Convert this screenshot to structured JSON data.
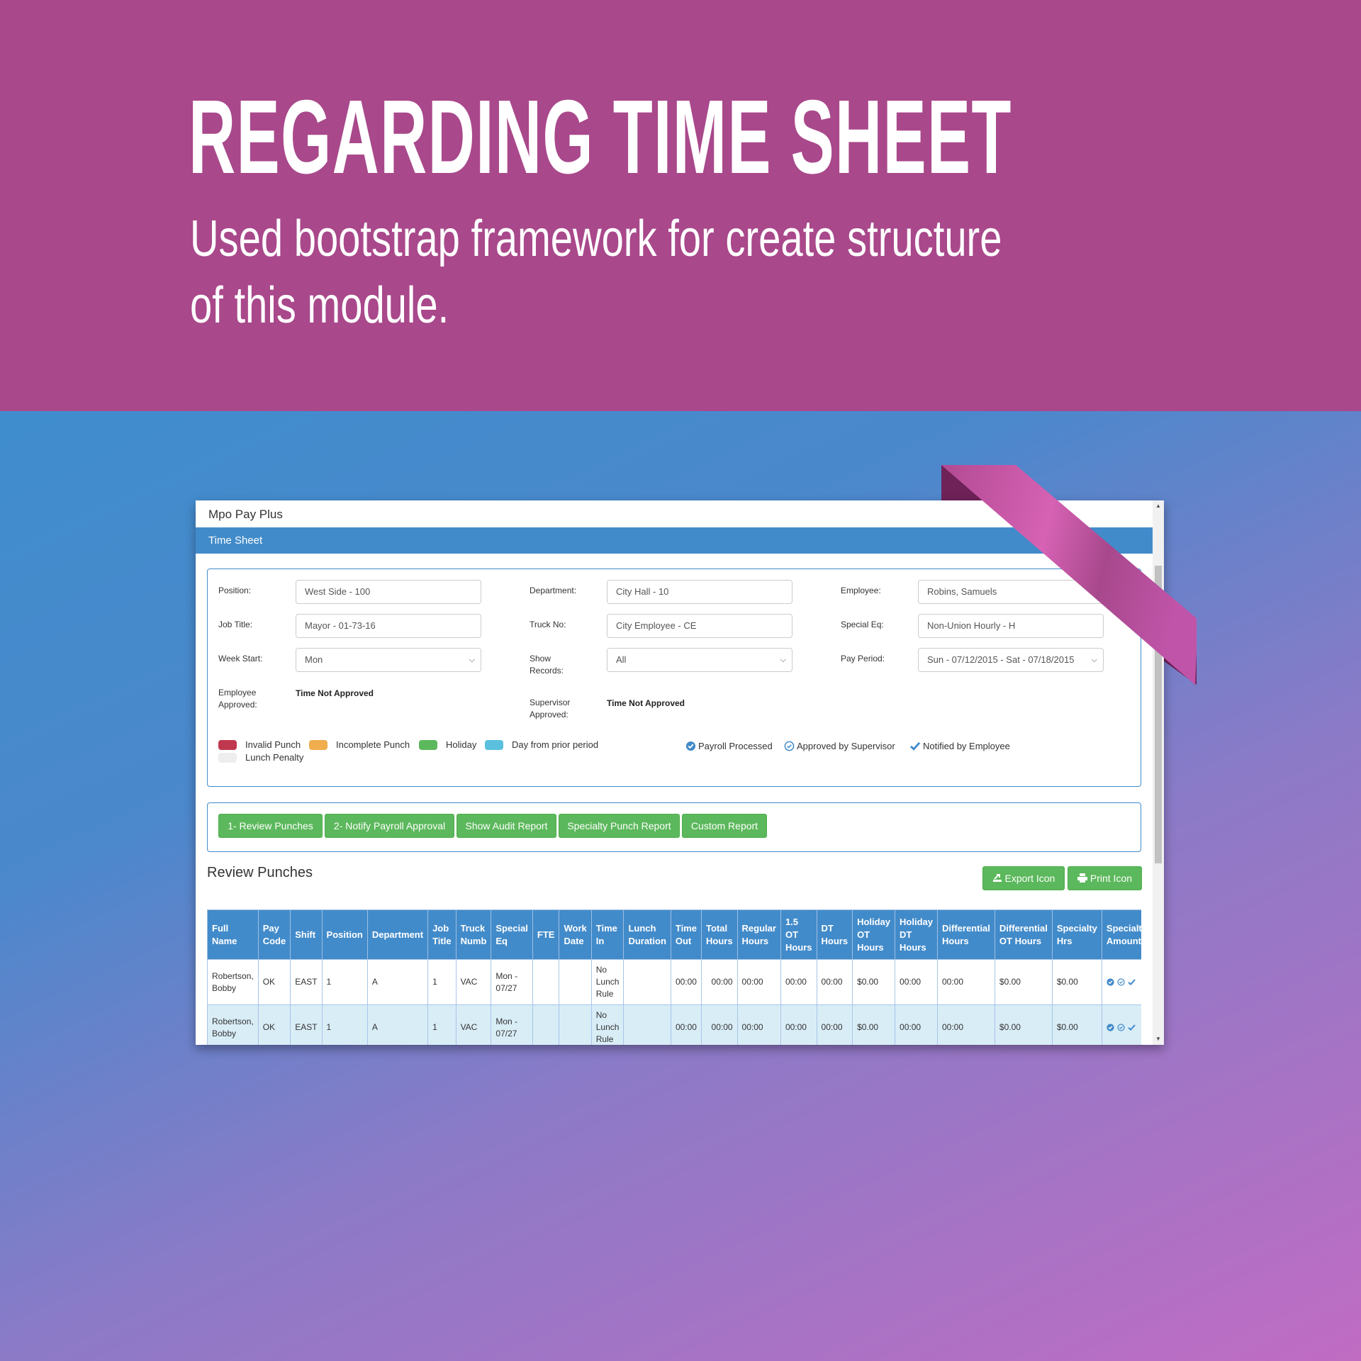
{
  "banner": {
    "headline": "REGARDING TIME SHEET",
    "subhead_line1": "Used bootstrap framework for create structure",
    "subhead_line2": "of this module."
  },
  "app": {
    "title": "Mpo Pay Plus",
    "header": "Time Sheet"
  },
  "filters": {
    "position": {
      "label": "Position:",
      "value": "West Side - 100"
    },
    "job_title": {
      "label": "Job Title:",
      "value": "Mayor - 01-73-16"
    },
    "week_start": {
      "label": "Week Start:",
      "value": "Mon"
    },
    "employee_approved": {
      "label_line1": "Employee",
      "label_line2": "Approved:",
      "value": "Time Not Approved"
    },
    "department": {
      "label": "Department:",
      "value": "City Hall - 10"
    },
    "truck_no": {
      "label": "Truck No:",
      "value": "City Employee - CE"
    },
    "show_records": {
      "label_line1": "Show",
      "label_line2": "Records:",
      "value": "All"
    },
    "supervisor_approved": {
      "label_line1": "Supervisor",
      "label_line2": "Approved:",
      "value": "Time Not Approved"
    },
    "employee": {
      "label": "Employee:",
      "value": "Robins, Samuels"
    },
    "special_eq": {
      "label": "Special Eq:",
      "value": "Non-Union Hourly - H"
    },
    "pay_period": {
      "label": "Pay Period:",
      "value": "Sun - 07/12/2015 - Sat - 07/18/2015"
    }
  },
  "legend": {
    "colors": [
      {
        "label": "Invalid Punch",
        "color": "#c0384f"
      },
      {
        "label": "Incomplete Punch",
        "color": "#f0ad4e"
      },
      {
        "label": "Holiday",
        "color": "#5cb85c"
      },
      {
        "label": "Day from prior period",
        "color": "#5bc0de"
      },
      {
        "label": "Lunch Penalty",
        "color": "#eeeeee"
      }
    ],
    "statuses": [
      {
        "label": "Payroll Processed",
        "icon": "check-circle-solid-icon"
      },
      {
        "label": "Approved by Supervisor",
        "icon": "check-circle-outline-icon"
      },
      {
        "label": "Notified by Employee",
        "icon": "check-icon"
      }
    ]
  },
  "actions": [
    "1- Review Punches",
    "2- Notify Payroll Approval",
    "Show Audit Report",
    "Specialty Punch Report",
    "Custom Report"
  ],
  "review": {
    "title": "Review Punches",
    "export_label": "Export Icon",
    "print_label": "Print Icon"
  },
  "table": {
    "columns": [
      "Full Name",
      "Pay Code",
      "Shift",
      "Position",
      "Department",
      "Job Title",
      "Truck Numb",
      "Special Eq",
      "FTE",
      "Work Date",
      "Time In",
      "Lunch Duration",
      "Time Out",
      "Total Hours",
      "Regular Hours",
      "1.5 OT Hours",
      "DT Hours",
      "Holiday OT Hours",
      "Holiday DT Hours",
      "Differential Hours",
      "Differential OT Hours",
      "Specialty Hrs",
      "Specialty Amount"
    ],
    "rows": [
      [
        "Robertson, Bobby",
        "OK",
        "EAST",
        "1",
        "A",
        "1",
        "VAC",
        "Mon - 07/27",
        "",
        "",
        "No Lunch Rule",
        "",
        "00:00",
        "00:00",
        "00:00",
        "00:00",
        "00:00",
        "$0.00",
        "00:00",
        "00:00",
        "$0.00",
        "$0.00",
        ""
      ],
      [
        "Robertson, Bobby",
        "OK",
        "EAST",
        "1",
        "A",
        "1",
        "VAC",
        "Mon - 07/27",
        "",
        "",
        "No Lunch Rule",
        "",
        "00:00",
        "00:00",
        "00:00",
        "00:00",
        "00:00",
        "$0.00",
        "00:00",
        "00:00",
        "$0.00",
        "$0.00",
        ""
      ]
    ]
  },
  "colors": {
    "banner": "#a9488b",
    "primary": "#428bca",
    "success": "#5cb85c",
    "alt_row": "#d9edf7"
  }
}
